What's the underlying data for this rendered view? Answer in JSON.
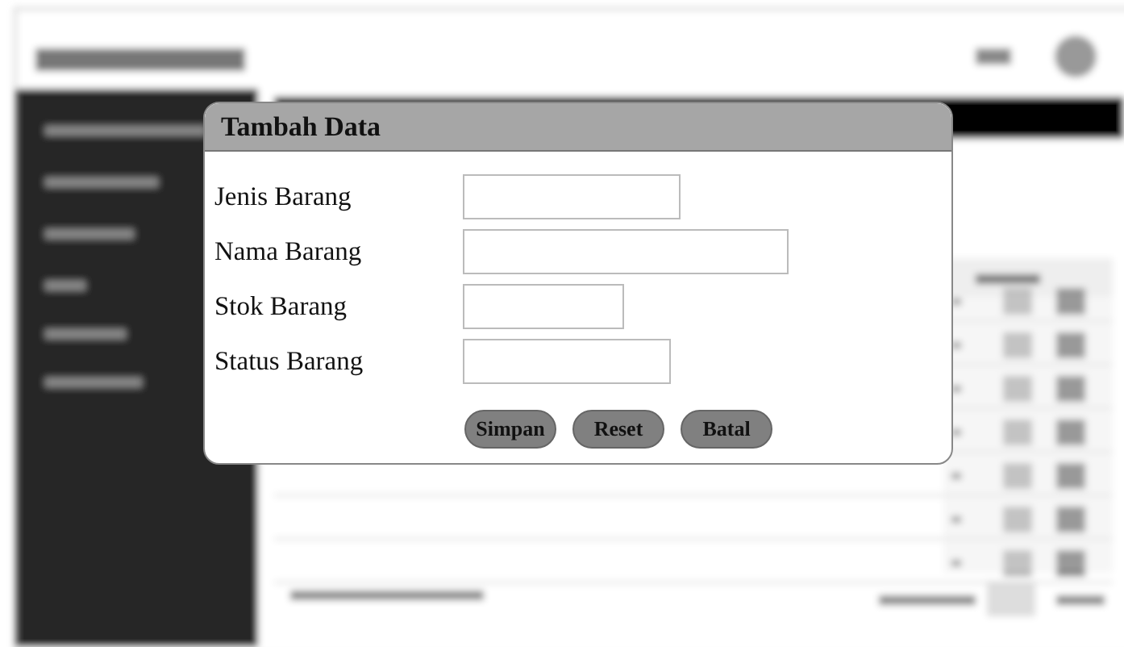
{
  "dialog": {
    "title": "Tambah Data",
    "fields": [
      {
        "label": "Jenis Barang"
      },
      {
        "label": "Nama Barang"
      },
      {
        "label": "Stok Barang"
      },
      {
        "label": "Status Barang"
      }
    ],
    "buttons": [
      "Simpan",
      "Reset",
      "Batal"
    ]
  }
}
